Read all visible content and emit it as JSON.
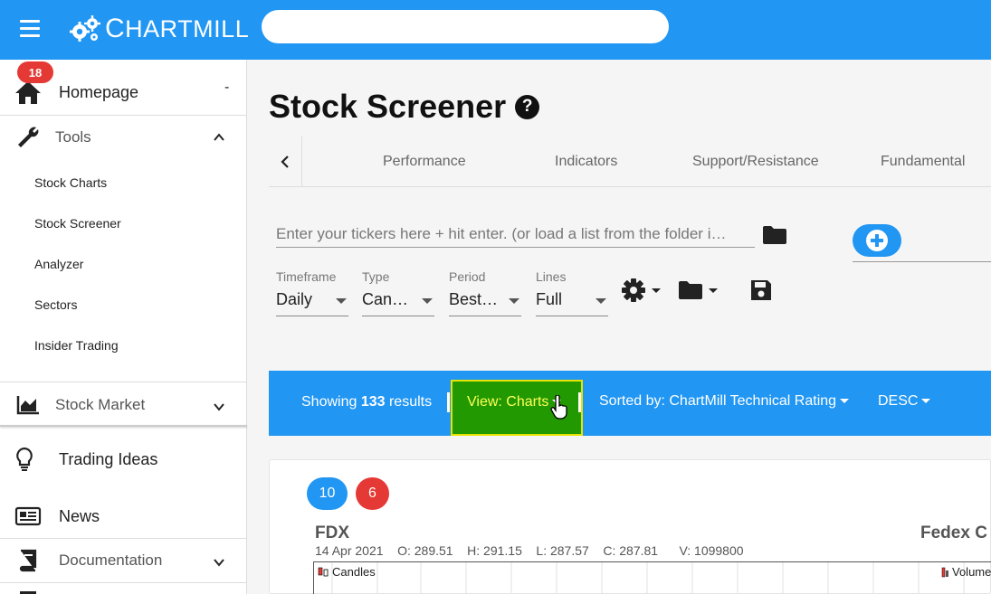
{
  "header": {
    "logo_text_big": "C",
    "logo_text_rest": "HARTMILL",
    "search_placeholder": ""
  },
  "sidebar": {
    "homepage": {
      "label": "Homepage",
      "badge": "18",
      "marker": "-"
    },
    "tools": {
      "label": "Tools"
    },
    "sub_items": [
      "Stock Charts",
      "Stock Screener",
      "Analyzer",
      "Sectors",
      "Insider Trading"
    ],
    "stock_market": {
      "label": "Stock Market"
    },
    "trading_ideas": {
      "label": "Trading Ideas"
    },
    "news": {
      "label": "News"
    },
    "documentation": {
      "label": "Documentation"
    }
  },
  "main": {
    "title": "Stock Screener",
    "help": "?",
    "tabs": [
      "Performance",
      "Indicators",
      "Support/Resistance",
      "Fundamental"
    ],
    "ticker_placeholder": "Enter your tickers here + hit enter. (or load a list from the folder i…",
    "selects": {
      "timeframe": {
        "label": "Timeframe",
        "value": "Daily"
      },
      "type": {
        "label": "Type",
        "value": "Can…"
      },
      "period": {
        "label": "Period",
        "value": "Best…"
      },
      "lines": {
        "label": "Lines",
        "value": "Full"
      }
    }
  },
  "results": {
    "showing_prefix": "Showing ",
    "count": "133",
    "showing_suffix": " results",
    "view_label": "View: Charts",
    "sort_label": "Sorted by: ChartMill Technical Rating",
    "direction": "DESC"
  },
  "chart_card": {
    "pill_blue": "10",
    "pill_red": "6",
    "ticker": "FDX",
    "company": "Fedex C",
    "date": "14 Apr 2021",
    "open": "O: 289.51",
    "high": "H: 291.15",
    "low": "L: 287.57",
    "close": "C: 287.81",
    "volume": "V: 1099800",
    "legend_candles": "Candles",
    "legend_volume": "Volume"
  },
  "colors": {
    "brand_blue": "#2196f3",
    "badge_red": "#e53935",
    "view_green": "#229900",
    "view_text": "#ffff57"
  }
}
